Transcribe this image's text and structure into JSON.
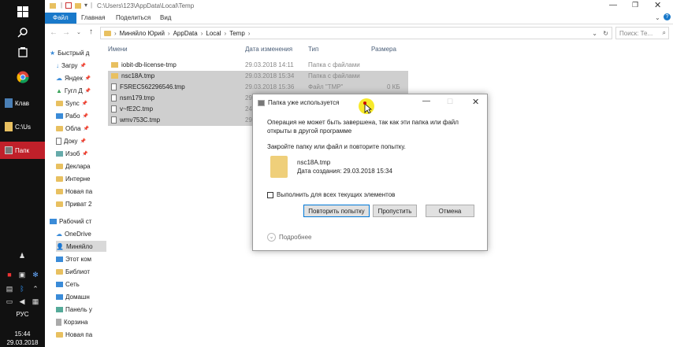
{
  "taskbar": {
    "apps": [
      {
        "label": "Клав"
      },
      {
        "label": "C:\\Us"
      },
      {
        "label": "Папк"
      }
    ],
    "lang": "РУС",
    "time": "15:44",
    "date": "29.03.2018"
  },
  "explorer": {
    "title_path": "C:\\Users\\123\\AppData\\Local\\Temp",
    "ribbon_tabs": [
      "Файл",
      "Главная",
      "Поделиться",
      "Вид"
    ],
    "breadcrumb": [
      "Миняйло Юрий",
      "AppData",
      "Local",
      "Temp"
    ],
    "search_placeholder": "Поиск: Те..."
  },
  "nav": {
    "items": [
      {
        "label": "Быстрый д",
        "pinned": false
      },
      {
        "label": "Загру",
        "pinned": true
      },
      {
        "label": "Яндек",
        "pinned": true
      },
      {
        "label": "Гугл Д",
        "pinned": true
      },
      {
        "label": "Sync",
        "pinned": true
      },
      {
        "label": "Рабо",
        "pinned": true
      },
      {
        "label": "Обла",
        "pinned": true
      },
      {
        "label": "Доку",
        "pinned": true
      },
      {
        "label": "Изоб",
        "pinned": true
      },
      {
        "label": "Деклара",
        "pinned": false
      },
      {
        "label": "Интерне",
        "pinned": false
      },
      {
        "label": "Новая па",
        "pinned": false
      },
      {
        "label": "Приват 2",
        "pinned": false
      },
      {
        "label": "Рабочий ст",
        "pinned": false
      },
      {
        "label": "OneDrive",
        "pinned": false
      },
      {
        "label": "Миняйло",
        "pinned": false
      },
      {
        "label": "Этот ком",
        "pinned": false
      },
      {
        "label": "Библиот",
        "pinned": false
      },
      {
        "label": "Сеть",
        "pinned": false
      },
      {
        "label": "Домашн",
        "pinned": false
      },
      {
        "label": "Панель у",
        "pinned": false
      },
      {
        "label": "Корзина",
        "pinned": false
      },
      {
        "label": "Новая па",
        "pinned": false
      }
    ]
  },
  "files": {
    "columns": [
      "Имени",
      "Дата изменения",
      "Тип",
      "Размера"
    ],
    "rows": [
      {
        "name": "iobit-db-license-tmp",
        "date": "29.03.2018 14:11",
        "type": "Папка с файлами",
        "size": "",
        "kind": "folder",
        "selected": false
      },
      {
        "name": "nsc18A.tmp",
        "date": "29.03.2018 15:34",
        "type": "Папка с файлами",
        "size": "",
        "kind": "folder",
        "selected": true
      },
      {
        "name": "FSREC562296546.tmp",
        "date": "29.03.2018 15:36",
        "type": "Файл \"TMP\"",
        "size": "0 КБ",
        "kind": "file",
        "selected": true
      },
      {
        "name": "nsm179.tmp",
        "date": "29",
        "type": "",
        "size": "",
        "kind": "file",
        "selected": true
      },
      {
        "name": "v~fE2C.tmp",
        "date": "24",
        "type": "",
        "size": "",
        "kind": "file",
        "selected": true
      },
      {
        "name": "wmv753C.tmp",
        "date": "29",
        "type": "",
        "size": "",
        "kind": "file",
        "selected": true
      }
    ]
  },
  "dialog": {
    "title": "Папка уже используется",
    "message": "Операция не может быть завершена, так как эти папка или файл открыты в другой программе",
    "instruction": "Закройте папку или файл и повторите попытку.",
    "item_name": "nsc18A.tmp",
    "item_created": "Дата создания: 29.03.2018 15:34",
    "checkbox_label": "Выполнить для всех текущих элементов",
    "btn_retry": "Повторить попытку",
    "btn_skip": "Пропустить",
    "btn_cancel": "Отмена",
    "details": "Подробнее"
  },
  "colors": {
    "accent": "#0078d7",
    "taskbar": "#111111",
    "active_app": "#c0202a",
    "cursor_highlight": "#f7e92a"
  }
}
